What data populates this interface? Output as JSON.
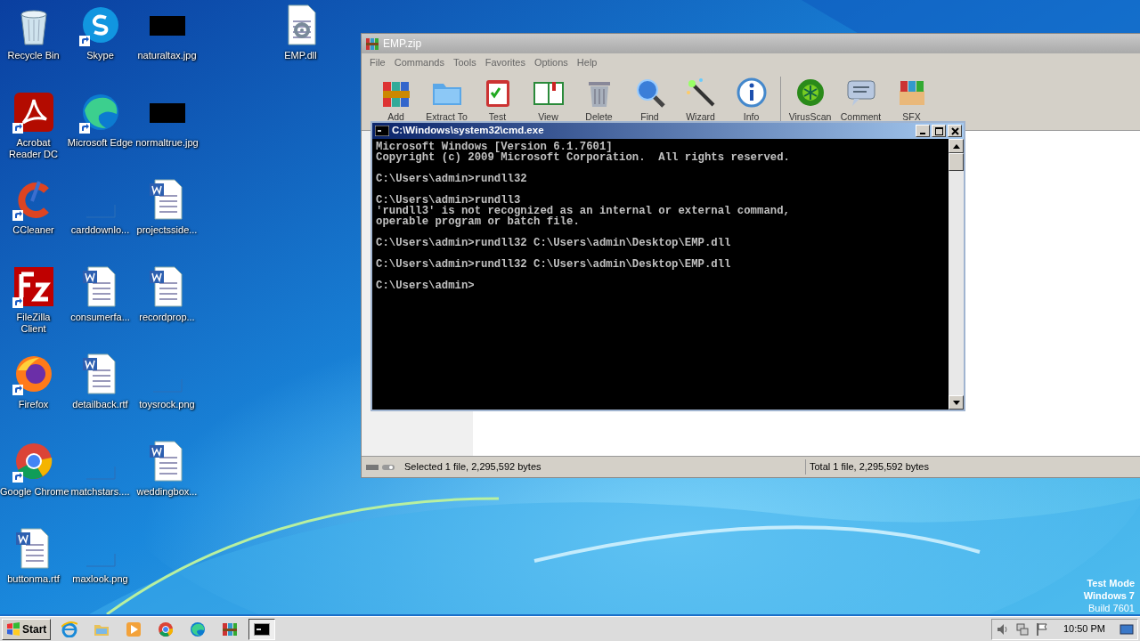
{
  "desktop_columns": [
    [
      {
        "label": "Recycle Bin",
        "kind": "recycle",
        "shortcut": false
      },
      {
        "label": "Acrobat Reader DC",
        "kind": "acrobat",
        "shortcut": true
      },
      {
        "label": "CCleaner",
        "kind": "ccleaner",
        "shortcut": true
      },
      {
        "label": "FileZilla Client",
        "kind": "filezilla",
        "shortcut": true
      },
      {
        "label": "Firefox",
        "kind": "firefox",
        "shortcut": true
      },
      {
        "label": "Google Chrome",
        "kind": "chrome",
        "shortcut": true
      },
      {
        "label": "buttonma.rtf",
        "kind": "word",
        "shortcut": false
      }
    ],
    [
      {
        "label": "Skype",
        "kind": "skype",
        "shortcut": true
      },
      {
        "label": "Microsoft Edge",
        "kind": "edge",
        "shortcut": true
      },
      {
        "label": "carddownlo...",
        "kind": "blank",
        "shortcut": false
      },
      {
        "label": "consumerfa...",
        "kind": "word",
        "shortcut": false
      },
      {
        "label": "detailback.rtf",
        "kind": "word",
        "shortcut": false
      },
      {
        "label": "matchstars....",
        "kind": "blank",
        "shortcut": false
      },
      {
        "label": "maxlook.png",
        "kind": "blank",
        "shortcut": false
      }
    ],
    [
      {
        "label": "naturaltax.jpg",
        "kind": "dark",
        "shortcut": false
      },
      {
        "label": "normaltrue.jpg",
        "kind": "dark",
        "shortcut": false
      },
      {
        "label": "projectsside...",
        "kind": "word",
        "shortcut": false
      },
      {
        "label": "recordprop...",
        "kind": "word",
        "shortcut": false
      },
      {
        "label": "toysrock.png",
        "kind": "blank",
        "shortcut": false
      },
      {
        "label": "weddingbox...",
        "kind": "word",
        "shortcut": false
      }
    ],
    [
      {
        "label": "EMP.dll",
        "kind": "dll",
        "shortcut": false
      }
    ]
  ],
  "archiver": {
    "title": "EMP.zip",
    "menu": [
      "File",
      "Commands",
      "Tools",
      "Favorites",
      "Options",
      "Help"
    ],
    "toolbar": [
      {
        "label": "Add",
        "kind": "add"
      },
      {
        "label": "Extract To",
        "kind": "extract"
      },
      {
        "label": "Test",
        "kind": "test"
      },
      {
        "label": "View",
        "kind": "view"
      },
      {
        "label": "Delete",
        "kind": "delete"
      },
      {
        "label": "Find",
        "kind": "find"
      },
      {
        "label": "Wizard",
        "kind": "wizard"
      },
      {
        "label": "Info",
        "kind": "info"
      },
      {
        "label": "VirusScan",
        "kind": "virus"
      },
      {
        "label": "Comment",
        "kind": "comment"
      },
      {
        "label": "SFX",
        "kind": "sfx"
      }
    ],
    "status_selected": "Selected 1 file, 2,295,592 bytes",
    "status_total": "Total 1 file, 2,295,592 bytes"
  },
  "console": {
    "title": "C:\\Windows\\system32\\cmd.exe",
    "blocks": [
      [
        "Microsoft Windows [Version 6.1.7601]",
        "Copyright (c) 2009 Microsoft Corporation.  All rights reserved."
      ],
      [
        "C:\\Users\\admin>rundll32"
      ],
      [
        "C:\\Users\\admin>rundll3",
        "'rundll3' is not recognized as an internal or external command,",
        "operable program or batch file."
      ],
      [
        "C:\\Users\\admin>rundll32 C:\\Users\\admin\\Desktop\\EMP.dll"
      ],
      [
        "C:\\Users\\admin>rundll32 C:\\Users\\admin\\Desktop\\EMP.dll"
      ],
      [
        "C:\\Users\\admin>"
      ]
    ]
  },
  "os_notice": [
    "Test Mode",
    "Windows 7",
    "Build 7601"
  ],
  "taskbar": {
    "start": "Start",
    "apps": [
      {
        "kind": "ie",
        "selected": false
      },
      {
        "kind": "explorer",
        "selected": false
      },
      {
        "kind": "media",
        "selected": false
      },
      {
        "kind": "chrome",
        "selected": false
      },
      {
        "kind": "edge",
        "selected": false
      },
      {
        "kind": "winrar",
        "selected": false
      },
      {
        "kind": "cmd",
        "selected": true
      }
    ],
    "clock": "10:50 PM"
  }
}
